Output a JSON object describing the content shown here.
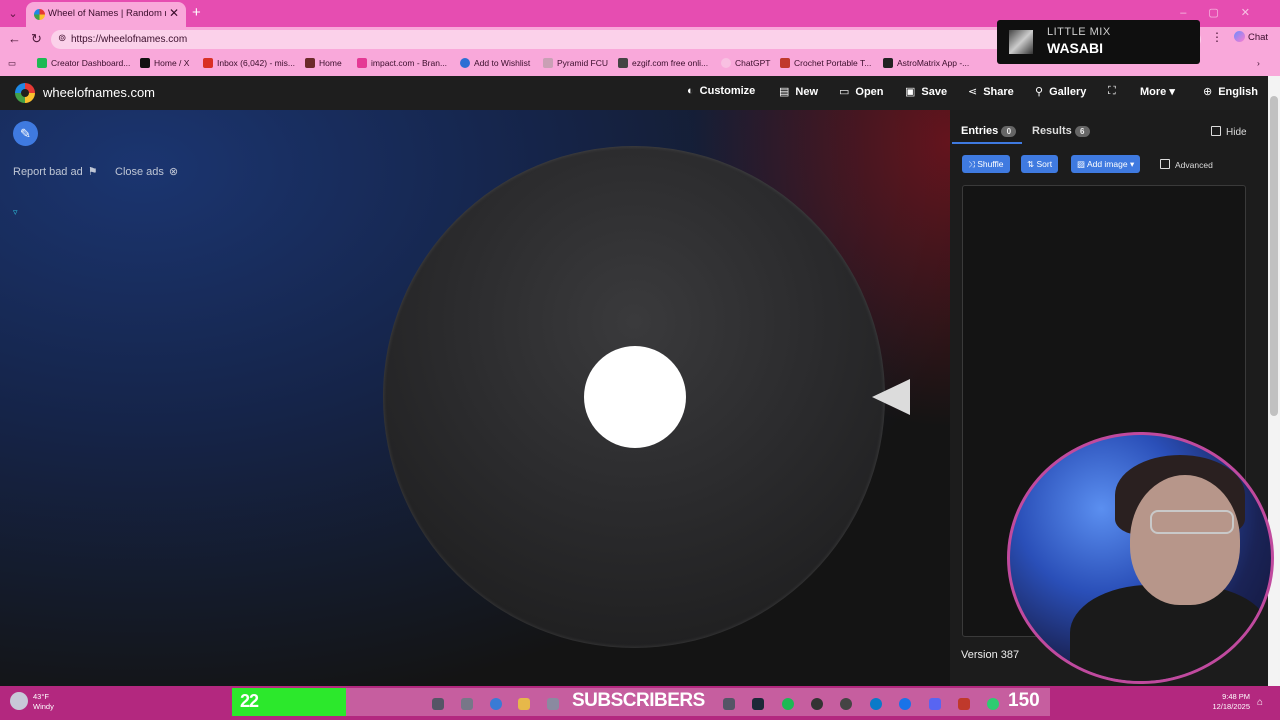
{
  "browser": {
    "tab_title": "Wheel of Names | Random name",
    "url": "https://wheelofnames.com",
    "chat_label": "Chat",
    "bookmarks": [
      {
        "label": "Creator Dashboard...",
        "color": "#1db954"
      },
      {
        "label": "Home / X",
        "color": "#111111"
      },
      {
        "label": "Inbox (6,042) - mis...",
        "color": "#d93025"
      },
      {
        "label": "Home",
        "color": "#6b2a2a"
      },
      {
        "label": "impact.com - Bran...",
        "color": "#e53995"
      },
      {
        "label": "Add to Wishlist",
        "color": "#2c6fd4"
      },
      {
        "label": "Pyramid FCU",
        "color": "#c9a0b5"
      },
      {
        "label": "ezgif.com free onli...",
        "color": "#444444"
      },
      {
        "label": "ChatGPT",
        "color": "#f9c0e2"
      },
      {
        "label": "Crochet Portable T...",
        "color": "#c0392b"
      },
      {
        "label": "AstroMatrix App -...",
        "color": "#222222"
      }
    ]
  },
  "music": {
    "artist": "LITTLE MIX",
    "song": "WASABI"
  },
  "header": {
    "site_name": "wheelofnames.com",
    "buttons": {
      "customize": "Customize",
      "new": "New",
      "open": "Open",
      "save": "Save",
      "share": "Share",
      "gallery": "Gallery",
      "more": "More",
      "language": "English"
    }
  },
  "stage": {
    "report_ad": "Report bad ad",
    "close_ads": "Close ads"
  },
  "panel": {
    "entries_label": "Entries",
    "entries_count": "0",
    "results_label": "Results",
    "results_count": "6",
    "hide_label": "Hide",
    "shuffle_label": "Shuffle",
    "sort_label": "Sort",
    "add_image_label": "Add image",
    "advanced_label": "Advanced",
    "version": "Version 387"
  },
  "taskbar": {
    "weather_temp": "43°F",
    "weather_desc": "Windy",
    "subs_left": "22",
    "subs_label": "SUBSCRIBERS",
    "subs_right": "150",
    "time": "9:48 PM",
    "date": "12/18/2025"
  },
  "icons": {
    "customize": "palette-icon",
    "new": "document-icon",
    "open": "folder-icon",
    "save": "floppy-icon",
    "share": "share-icon",
    "gallery": "search-icon",
    "fullscreen": "fullscreen-icon",
    "language": "globe-icon"
  },
  "colors": {
    "accent": "#3f7ae0",
    "browser_pink": "#e64db1",
    "subs_green": "#2ce82c"
  }
}
